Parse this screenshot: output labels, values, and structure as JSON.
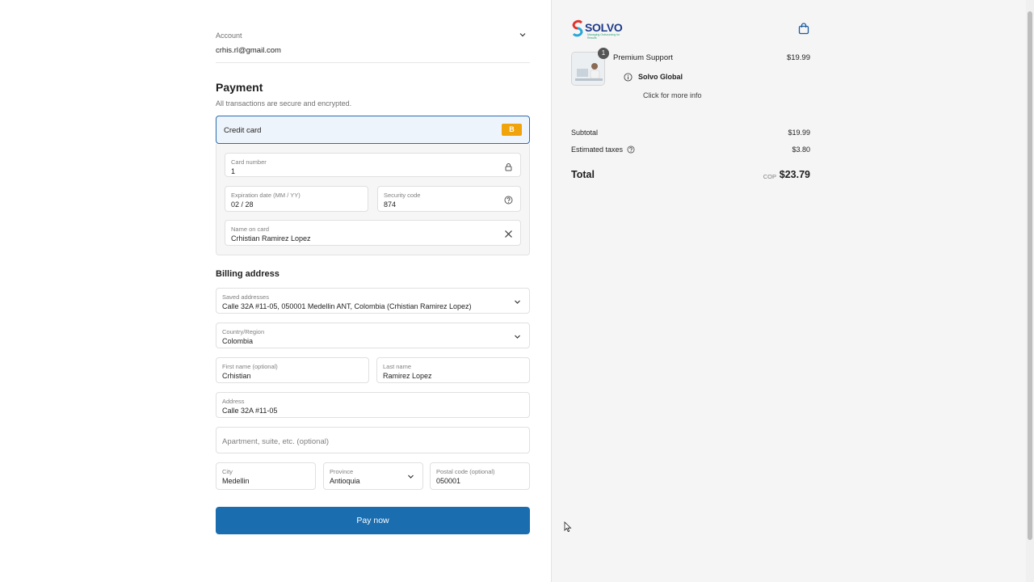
{
  "account": {
    "label": "Account",
    "email": "crhis.rl@gmail.com"
  },
  "payment": {
    "title": "Payment",
    "subtitle": "All transactions are secure and encrypted.",
    "method_label": "Credit card",
    "method_badge": "B",
    "card_number": {
      "label": "Card number",
      "value": "1"
    },
    "expiration": {
      "label": "Expiration date (MM / YY)",
      "value": "02 / 28"
    },
    "security_code": {
      "label": "Security code",
      "value": "874"
    },
    "name_on_card": {
      "label": "Name on card",
      "value": "Crhistian Ramirez Lopez"
    }
  },
  "billing": {
    "title": "Billing address",
    "saved": {
      "label": "Saved addresses",
      "value": "Calle 32A #11-05, 050001 Medellin ANT, Colombia (Crhistian Ramirez Lopez)"
    },
    "country": {
      "label": "Country/Region",
      "value": "Colombia"
    },
    "first_name": {
      "label": "First name (optional)",
      "value": "Crhistian"
    },
    "last_name": {
      "label": "Last name",
      "value": "Ramirez Lopez"
    },
    "address": {
      "label": "Address",
      "value": "Calle 32A #11-05"
    },
    "apartment": {
      "placeholder": "Apartment, suite, etc. (optional)"
    },
    "city": {
      "label": "City",
      "value": "Medellin"
    },
    "province": {
      "label": "Province",
      "value": "Antioquia"
    },
    "postal": {
      "label": "Postal code (optional)",
      "value": "050001"
    }
  },
  "pay_button": "Pay now",
  "summary": {
    "brand": "SOLVO",
    "brand_tagline": "Managing Outsourcing for Results",
    "item": {
      "quantity": "1",
      "name": "Premium Support",
      "price": "$19.99"
    },
    "info_title": "Solvo Global",
    "info_link": "Click for more info",
    "subtotal_label": "Subtotal",
    "subtotal_value": "$19.99",
    "taxes_label": "Estimated taxes",
    "taxes_value": "$3.80",
    "total_label": "Total",
    "currency": "COP",
    "total_value": "$23.79"
  },
  "colors": {
    "accent": "#1a6eb0",
    "badge": "#f0a30a",
    "selected_bg": "#eef4fb"
  }
}
